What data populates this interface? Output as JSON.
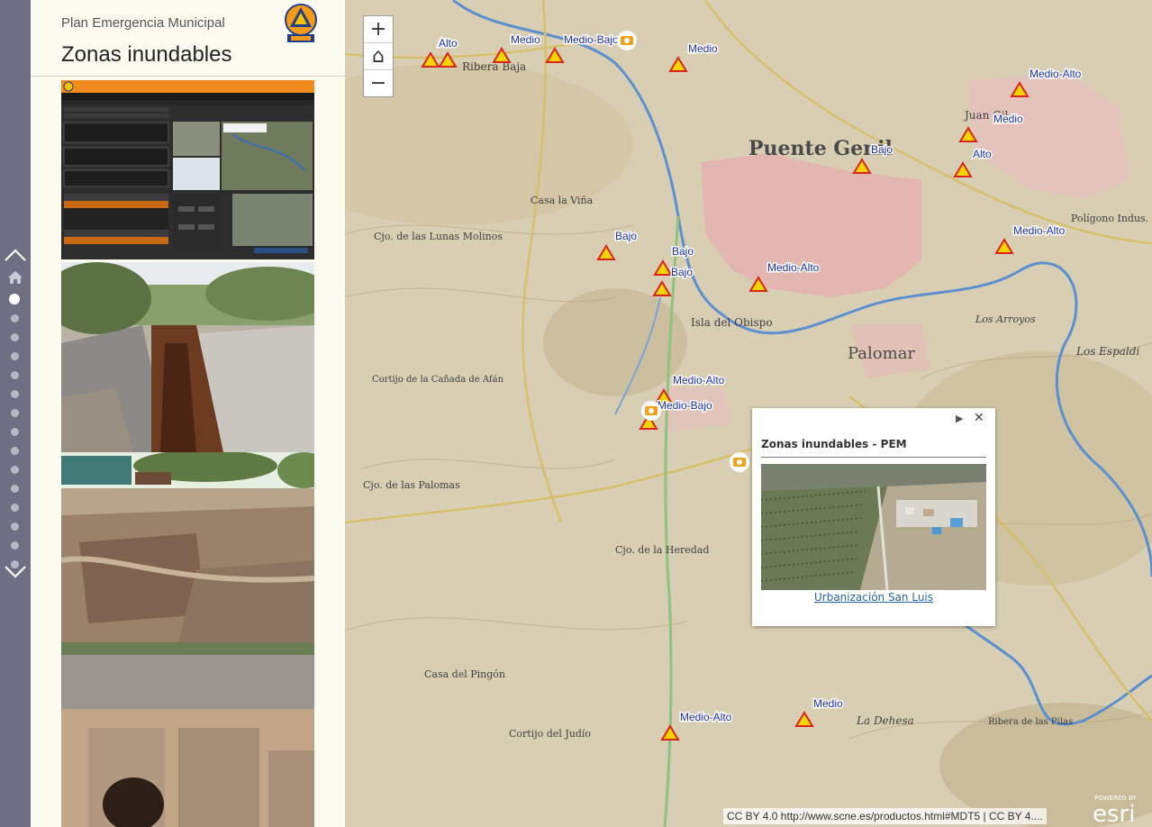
{
  "header": {
    "subtitle": "Plan Emergencia Municipal",
    "title": "Zonas inundables"
  },
  "nav": {
    "dot_count": 15
  },
  "map": {
    "place_labels": [
      "Puente Genil",
      "Palomar",
      "Isla del Obispo",
      "Juan Gil",
      "Ribera Baja",
      "Casa la Viña",
      "Cjo. de las Lunas Molinos",
      "Cortijo de la Cañada de Afán",
      "Cjo. de las Palomas",
      "Cjo. de la Heredad",
      "Casa del Pingón",
      "Cortijo del Judío",
      "La Dehesa",
      "Ribera de las Pilas",
      "Polígono Indus. San Pancrac",
      "Los Arroyos",
      "Los Espaldi"
    ],
    "markers": [
      {
        "label": "Alto"
      },
      {
        "label": "Alto"
      },
      {
        "label": "Medio"
      },
      {
        "label": "Medio-Bajo"
      },
      {
        "label": "Medio"
      },
      {
        "label": "Medio-Alto"
      },
      {
        "label": "Medio"
      },
      {
        "label": "Bajo"
      },
      {
        "label": "Alto"
      },
      {
        "label": "Medio-Alto"
      },
      {
        "label": "Bajo"
      },
      {
        "label": "Bajo"
      },
      {
        "label": "Bajo"
      },
      {
        "label": "Medio-Alto"
      },
      {
        "label": "Medio-Alto"
      },
      {
        "label": "Medio-Bajo"
      },
      {
        "label": "Medio"
      },
      {
        "label": "Medio-Alto"
      }
    ],
    "attribution": "CC BY 4.0 http://www.scne.es/productos.html#MDT5 | CC BY 4....",
    "esri_powered": "POWERED BY",
    "esri_brand": "esri"
  },
  "zoom": {
    "in": "+",
    "home": "⌂",
    "out": "−"
  },
  "popup": {
    "title": "Zonas inundables - PEM",
    "link": "Urbanización San Luis",
    "next": "▶",
    "close": "✕"
  },
  "colors": {
    "nav_bg": "#6e6f83",
    "sidebar_bg": "#fbfbf0",
    "marker_fill": "#f5d400",
    "marker_stroke": "#d9261c",
    "label_blue": "#1a2fb0",
    "river": "#5b8fd0"
  }
}
